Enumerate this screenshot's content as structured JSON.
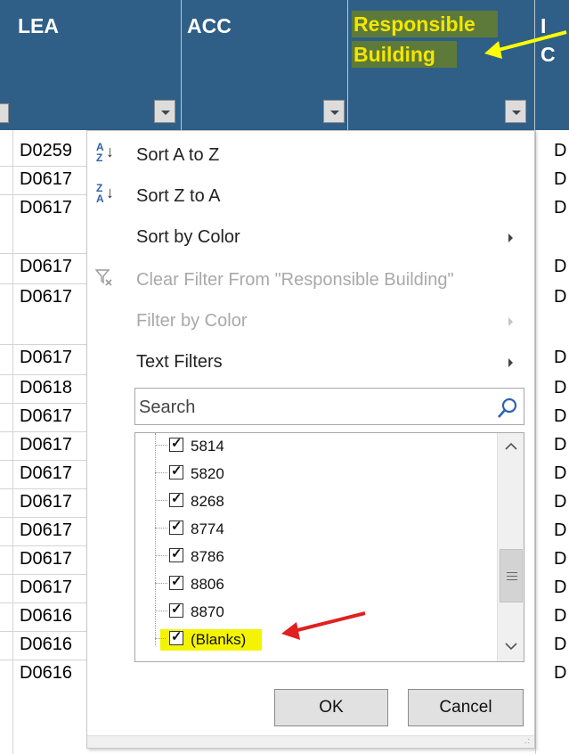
{
  "header": {
    "columns": [
      {
        "title": "LEA"
      },
      {
        "title": "ACC"
      },
      {
        "title_line1": "Responsible",
        "title_line2": "Building"
      },
      {
        "title_line1": "I",
        "title_line2": "C"
      }
    ]
  },
  "grid": {
    "lea_cells": [
      "D0259",
      "D0617",
      "D0617",
      "D0617",
      "D0617",
      "D0617",
      "D0618",
      "D0617",
      "D0617",
      "D0617",
      "D0617",
      "D0617",
      "D0617",
      "D0617",
      "D0616",
      "D0616",
      "D0616"
    ],
    "right_cells": [
      "D",
      "D",
      "D",
      "D",
      "D",
      "D",
      "D",
      "D",
      "D",
      "D",
      "D",
      "D",
      "D",
      "D",
      "D",
      "D",
      "D"
    ]
  },
  "menu": {
    "sort_az": {
      "label": "Sort A to Z"
    },
    "sort_za": {
      "label": "Sort Z to A"
    },
    "sort_by_color": {
      "label": "Sort by Color"
    },
    "clear_filter": {
      "label": "Clear Filter From \"Responsible Building\""
    },
    "filter_by_color": {
      "label": "Filter by Color"
    },
    "text_filters": {
      "label": "Text Filters"
    },
    "search": {
      "placeholder": "Search"
    },
    "list_items": [
      {
        "label": "5814",
        "checked": true
      },
      {
        "label": "5820",
        "checked": true
      },
      {
        "label": "8268",
        "checked": true
      },
      {
        "label": "8774",
        "checked": true
      },
      {
        "label": "8786",
        "checked": true
      },
      {
        "label": "8806",
        "checked": true
      },
      {
        "label": "8870",
        "checked": true
      },
      {
        "label": "(Blanks)",
        "checked": true
      }
    ],
    "ok_label": "OK",
    "cancel_label": "Cancel"
  },
  "icons": {
    "sort_az": "sort-ascending-icon",
    "sort_za": "sort-descending-icon",
    "clear_filter": "clear-filter-icon",
    "search": "search-icon",
    "submenu": "chevron-right-icon",
    "scroll_up": "chevron-up-icon",
    "scroll_down": "chevron-down-icon",
    "checkbox": "checkmark-icon"
  },
  "colors": {
    "header_bg": "#2f5f86",
    "highlight_text": "#f3e600",
    "highlight_bg": "#5d7a3a",
    "annotation_yellow": "#ffff00",
    "annotation_red": "#e02020",
    "icon_blue": "#2d63b0"
  }
}
